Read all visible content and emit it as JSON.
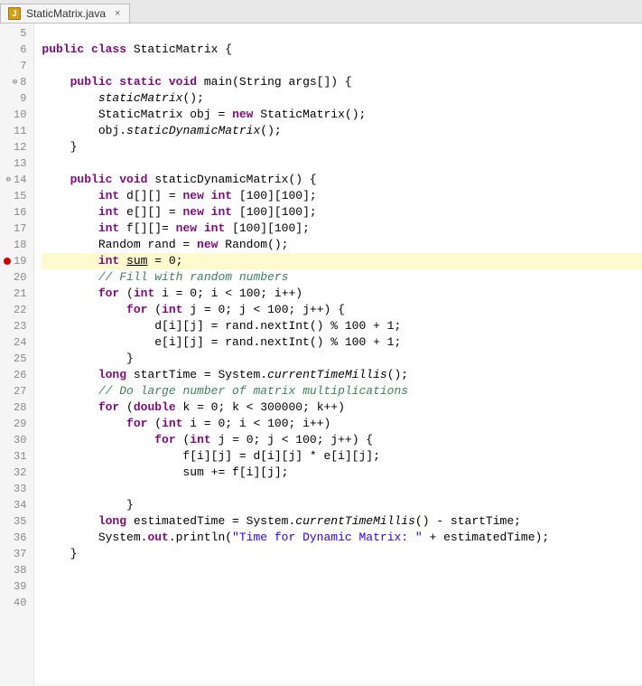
{
  "tab": {
    "icon_label": "J",
    "filename": "StaticMatrix.java",
    "close_symbol": "×"
  },
  "lines": [
    {
      "num": "5",
      "indent": 0,
      "tokens": []
    },
    {
      "num": "6",
      "indent": 0,
      "raw": "PUBLIC_CLASS"
    },
    {
      "num": "7",
      "indent": 0,
      "tokens": []
    },
    {
      "num": "8",
      "indent": 1,
      "raw": "MAIN_METHOD",
      "fold": true
    },
    {
      "num": "9",
      "indent": 2,
      "raw": "STATIC_MATRIX_CALL"
    },
    {
      "num": "10",
      "indent": 2,
      "raw": "OBJ_DECL"
    },
    {
      "num": "11",
      "indent": 2,
      "raw": "OBJ_METHOD"
    },
    {
      "num": "12",
      "indent": 1,
      "raw": "CLOSE_BRACE"
    },
    {
      "num": "13",
      "indent": 0,
      "tokens": []
    },
    {
      "num": "14",
      "indent": 1,
      "raw": "STATIC_DYN_METHOD",
      "fold": true
    },
    {
      "num": "15",
      "indent": 2,
      "raw": "INT_D"
    },
    {
      "num": "16",
      "indent": 2,
      "raw": "INT_E"
    },
    {
      "num": "17",
      "indent": 2,
      "raw": "INT_F"
    },
    {
      "num": "18",
      "indent": 2,
      "raw": "RANDOM_DECL"
    },
    {
      "num": "19",
      "indent": 2,
      "raw": "INT_SUM",
      "breakpoint": true
    },
    {
      "num": "20",
      "indent": 2,
      "raw": "COMMENT_FILL"
    },
    {
      "num": "21",
      "indent": 2,
      "raw": "FOR_I_100"
    },
    {
      "num": "22",
      "indent": 3,
      "raw": "FOR_J_100_OPEN"
    },
    {
      "num": "23",
      "indent": 4,
      "raw": "D_ASSIGN"
    },
    {
      "num": "24",
      "indent": 4,
      "raw": "E_ASSIGN"
    },
    {
      "num": "25",
      "indent": 3,
      "raw": "CLOSE_BRACE"
    },
    {
      "num": "26",
      "indent": 2,
      "raw": "LONG_START"
    },
    {
      "num": "27",
      "indent": 2,
      "raw": "COMMENT_DO"
    },
    {
      "num": "28",
      "indent": 2,
      "raw": "FOR_K_300000"
    },
    {
      "num": "29",
      "indent": 3,
      "raw": "FOR_I_100_INNER"
    },
    {
      "num": "30",
      "indent": 4,
      "raw": "FOR_J_100_INNER_OPEN"
    },
    {
      "num": "31",
      "indent": 5,
      "raw": "F_ASSIGN"
    },
    {
      "num": "32",
      "indent": 5,
      "raw": "SUM_PLUS"
    },
    {
      "num": "33",
      "indent": 4,
      "tokens": []
    },
    {
      "num": "34",
      "indent": 3,
      "raw": "CLOSE_BRACE_INDENT"
    },
    {
      "num": "35",
      "indent": 2,
      "raw": "LONG_EST"
    },
    {
      "num": "36",
      "indent": 2,
      "raw": "SYSTEM_OUT"
    },
    {
      "num": "37",
      "indent": 1,
      "raw": "CLOSE_BRACE"
    },
    {
      "num": "38",
      "indent": 0,
      "tokens": []
    },
    {
      "num": "39",
      "indent": 0,
      "tokens": []
    },
    {
      "num": "40",
      "indent": 0,
      "tokens": []
    }
  ]
}
